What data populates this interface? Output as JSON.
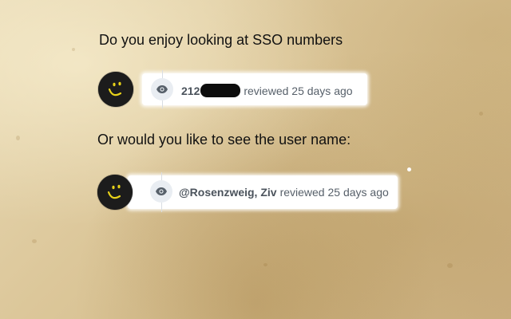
{
  "captions": {
    "first": "Do you enjoy looking at SSO numbers",
    "second": "Or would you like to see the user name:"
  },
  "review_sso": {
    "author_visible_prefix": "212",
    "author_redacted": true,
    "action": "reviewed 25 days ago",
    "icon": "eye-icon",
    "avatar_icon": "smiley-icon"
  },
  "review_username": {
    "author": "@Rosenzweig, Ziv",
    "action": "reviewed 25 days ago",
    "icon": "eye-icon",
    "avatar_icon": "smiley-icon"
  },
  "colors": {
    "avatar_bg": "#1c1c1c",
    "smiley": "#e8d21a",
    "badge_bg": "#e9edf2",
    "text_muted": "#57606a",
    "parchment": "#dcc79a"
  }
}
